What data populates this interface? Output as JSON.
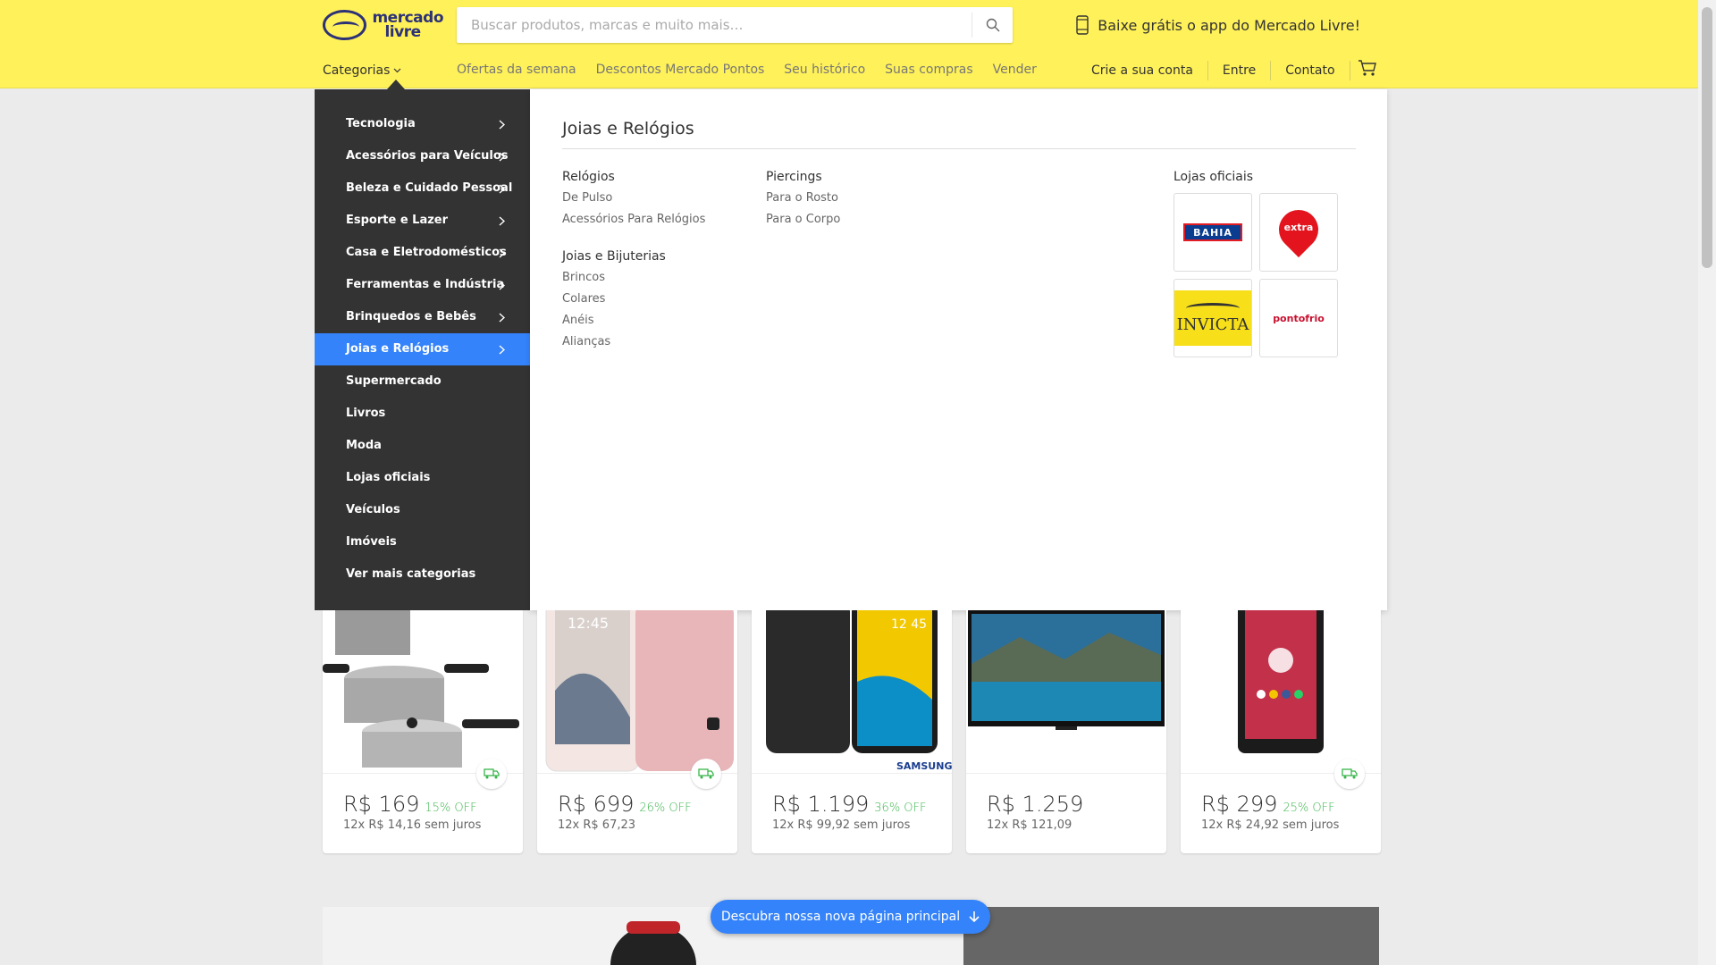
{
  "header": {
    "logo_text_line1": "mercado",
    "logo_text_line2": "livre",
    "search_placeholder": "Buscar produtos, marcas e muito mais…",
    "app_promo": "Baixe grátis o app do Mercado Livre!"
  },
  "nav": {
    "categories": "Categorias",
    "links": [
      "Ofertas da semana",
      "Descontos Mercado Pontos",
      "Seu histórico",
      "Suas compras",
      "Vender"
    ],
    "right": [
      "Crie a sua conta",
      "Entre",
      "Contato"
    ]
  },
  "menu": {
    "items": [
      {
        "label": "Tecnologia",
        "has_sub": true
      },
      {
        "label": "Acessórios para Veículos",
        "has_sub": true
      },
      {
        "label": "Beleza e Cuidado Pessoal",
        "has_sub": true
      },
      {
        "label": "Esporte e Lazer",
        "has_sub": true
      },
      {
        "label": "Casa e Eletrodomésticos",
        "has_sub": true
      },
      {
        "label": "Ferramentas e Indústria",
        "has_sub": true
      },
      {
        "label": "Brinquedos e Bebês",
        "has_sub": true
      },
      {
        "label": "Joias e Relógios",
        "has_sub": true,
        "active": true
      },
      {
        "label": "Supermercado",
        "has_sub": false
      },
      {
        "label": "Livros",
        "has_sub": false
      },
      {
        "label": "Moda",
        "has_sub": false
      },
      {
        "label": "Lojas oficiais",
        "has_sub": false
      },
      {
        "label": "Veículos",
        "has_sub": false
      },
      {
        "label": "Imóveis",
        "has_sub": false
      },
      {
        "label": "Ver mais categorias",
        "has_sub": false
      }
    ]
  },
  "panel": {
    "title": "Joias e Relógios",
    "col1": {
      "group1_title": "Relógios",
      "group1_links": [
        "De Pulso",
        "Acessórios Para Relógios"
      ],
      "group2_title": "Joias e Bijuterias",
      "group2_links": [
        "Brincos",
        "Colares",
        "Anéis",
        "Alianças"
      ]
    },
    "col2": {
      "group1_title": "Piercings",
      "group1_links": [
        "Para o Rosto",
        "Para o Corpo"
      ]
    },
    "stores_title": "Lojas oficiais",
    "stores": [
      "BAHIA",
      "extra",
      "INVICTA",
      "pontofrio"
    ]
  },
  "products": [
    {
      "price": "R$ 169",
      "off": "15% OFF",
      "installments": "12x R$ 14,16 sem juros",
      "free_shipping": true
    },
    {
      "price": "R$ 699",
      "off": "26% OFF",
      "installments": "12x R$ 67,23",
      "free_shipping": true
    },
    {
      "price": "R$ 1.199",
      "off": "36% OFF",
      "installments": "12x R$ 99,92 sem juros",
      "free_shipping": false
    },
    {
      "price": "R$ 1.259",
      "off": "",
      "installments": "12x R$ 121,09",
      "free_shipping": false
    },
    {
      "price": "R$ 299",
      "off": "25% OFF",
      "installments": "12x R$ 24,92 sem juros",
      "free_shipping": true
    }
  ],
  "product_brand": "SAMSUNG",
  "phone_time_1": "12:45",
  "phone_time_2": "12 45",
  "pill": "Descubra nossa nova página principal",
  "colors": {
    "header": "#fff159",
    "accent": "#3483fa",
    "menu": "#333333",
    "discount": "#39b54a"
  }
}
